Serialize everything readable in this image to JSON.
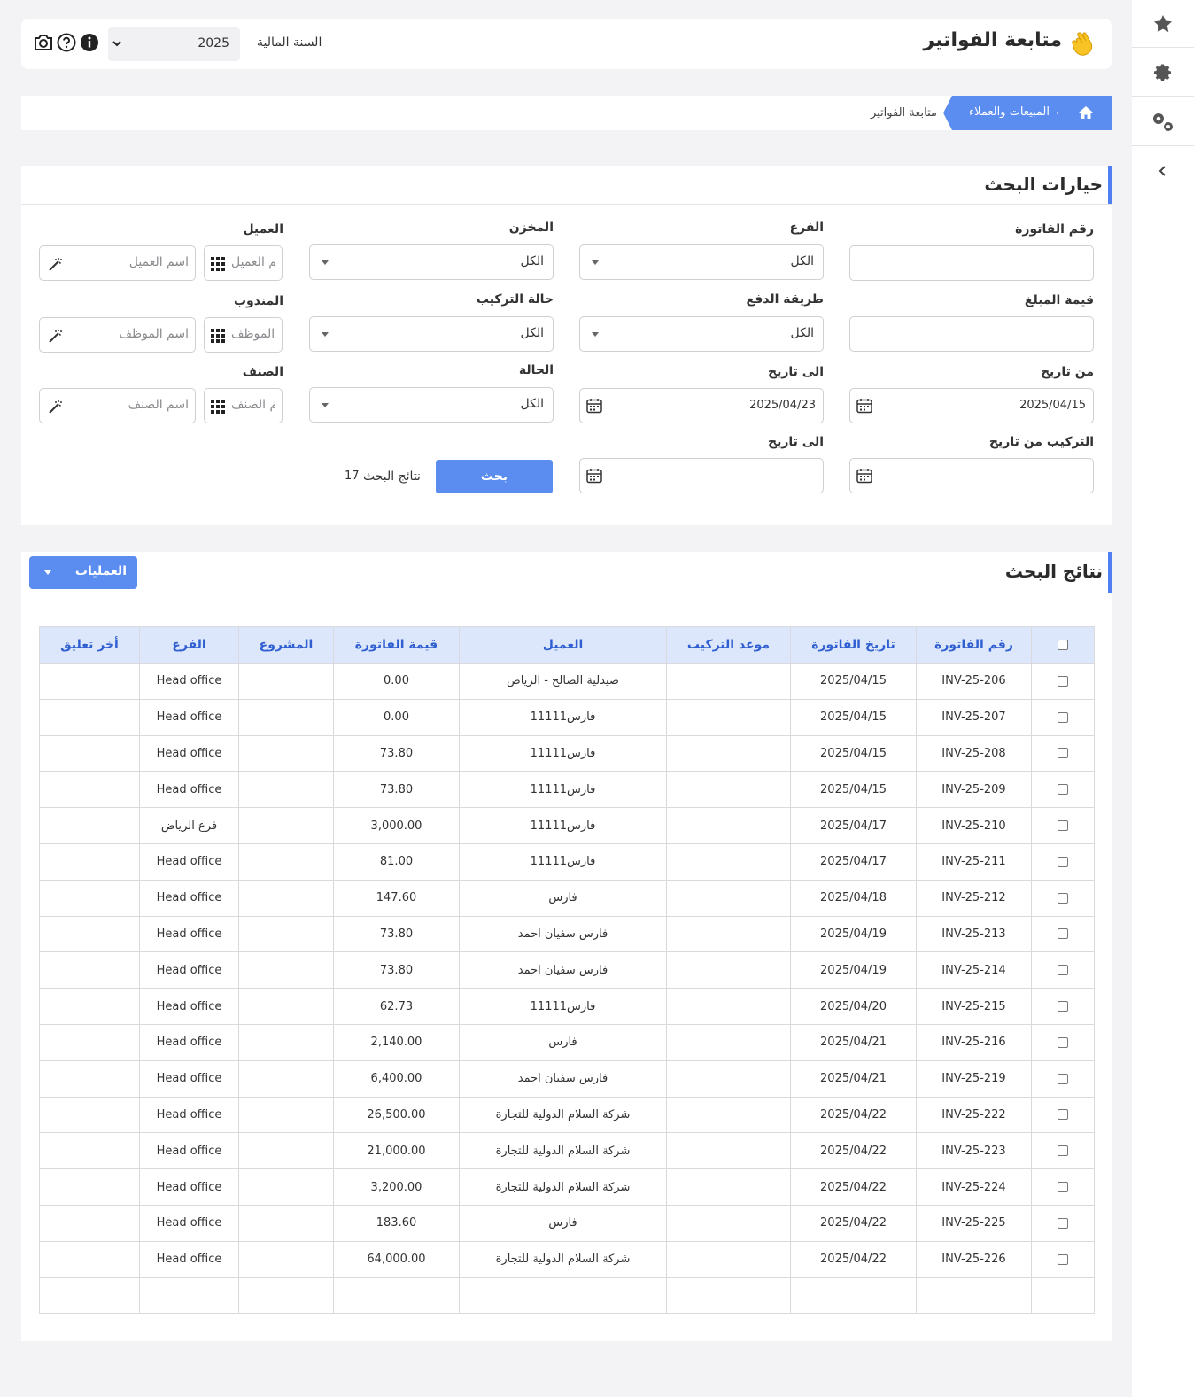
{
  "header": {
    "title": "متابعة الفواتير",
    "fiscal_year_label": "السنة المالية",
    "fiscal_year_value": "2025"
  },
  "breadcrumb": {
    "home_icon": "home-icon",
    "section": "المبيعات والعملاء",
    "current": "متابعة الفواتير"
  },
  "rail": {
    "icons": [
      "star-icon",
      "gear-icon",
      "gears-icon",
      "chevron-left-icon"
    ]
  },
  "search": {
    "title": "خيارات البحث",
    "invoice_no_label": "رقم الفاتورة",
    "branch_label": "الفرع",
    "branch_value": "الكل",
    "warehouse_label": "المخزن",
    "warehouse_value": "الكل",
    "customer_label": "العميل",
    "customer_no_placeholder": "رقم العميل",
    "customer_name_placeholder": "اسم العميل",
    "amount_label": "قيمة المبلغ",
    "payment_label": "طريقة الدفع",
    "payment_value": "الكل",
    "install_status_label": "حالة التركيب",
    "install_status_value": "الكل",
    "rep_label": "المندوب",
    "rep_no_placeholder": "رقم الموظف",
    "rep_name_placeholder": "اسم الموظف",
    "from_date_label": "من تاريخ",
    "from_date_value": "2025/04/15",
    "to_date_label": "الى تاريخ",
    "to_date_value": "2025/04/23",
    "status_label": "الحالة",
    "status_value": "الكل",
    "item_label": "الصنف",
    "item_no_placeholder": "رقم الصنف",
    "item_name_placeholder": "اسم الصنف",
    "install_from_label": "التركيب من تاريخ",
    "install_to_label": "الى تاريخ",
    "search_button": "بحث",
    "results_label": "نتائج البحث",
    "results_count": "17"
  },
  "results": {
    "title": "نتائج البحث",
    "operations_button": "العمليات",
    "columns": [
      "رقم الفاتورة",
      "تاريخ الفاتورة",
      "موعد التركيب",
      "العميل",
      "قيمة الفاتورة",
      "المشروع",
      "الفرع",
      "أخر تعليق"
    ],
    "rows": [
      {
        "invoice": "INV-25-206",
        "date": "2025/04/15",
        "install": "",
        "customer": "صيدلية الصالح - الرياض",
        "amount": "0.00",
        "project": "",
        "branch": "Head office",
        "comment": ""
      },
      {
        "invoice": "INV-25-207",
        "date": "2025/04/15",
        "install": "",
        "customer": "فارس11111",
        "amount": "0.00",
        "project": "",
        "branch": "Head office",
        "comment": ""
      },
      {
        "invoice": "INV-25-208",
        "date": "2025/04/15",
        "install": "",
        "customer": "فارس11111",
        "amount": "73.80",
        "project": "",
        "branch": "Head office",
        "comment": ""
      },
      {
        "invoice": "INV-25-209",
        "date": "2025/04/15",
        "install": "",
        "customer": "فارس11111",
        "amount": "73.80",
        "project": "",
        "branch": "Head office",
        "comment": ""
      },
      {
        "invoice": "INV-25-210",
        "date": "2025/04/17",
        "install": "",
        "customer": "فارس11111",
        "amount": "3,000.00",
        "project": "",
        "branch": "فرع الرياض",
        "comment": ""
      },
      {
        "invoice": "INV-25-211",
        "date": "2025/04/17",
        "install": "",
        "customer": "فارس11111",
        "amount": "81.00",
        "project": "",
        "branch": "Head office",
        "comment": ""
      },
      {
        "invoice": "INV-25-212",
        "date": "2025/04/18",
        "install": "",
        "customer": "فارس",
        "amount": "147.60",
        "project": "",
        "branch": "Head office",
        "comment": ""
      },
      {
        "invoice": "INV-25-213",
        "date": "2025/04/19",
        "install": "",
        "customer": "فارس سفيان احمد",
        "amount": "73.80",
        "project": "",
        "branch": "Head office",
        "comment": ""
      },
      {
        "invoice": "INV-25-214",
        "date": "2025/04/19",
        "install": "",
        "customer": "فارس سفيان احمد",
        "amount": "73.80",
        "project": "",
        "branch": "Head office",
        "comment": ""
      },
      {
        "invoice": "INV-25-215",
        "date": "2025/04/20",
        "install": "",
        "customer": "فارس11111",
        "amount": "62.73",
        "project": "",
        "branch": "Head office",
        "comment": ""
      },
      {
        "invoice": "INV-25-216",
        "date": "2025/04/21",
        "install": "",
        "customer": "فارس",
        "amount": "2,140.00",
        "project": "",
        "branch": "Head office",
        "comment": ""
      },
      {
        "invoice": "INV-25-219",
        "date": "2025/04/21",
        "install": "",
        "customer": "فارس سفيان احمد",
        "amount": "6,400.00",
        "project": "",
        "branch": "Head office",
        "comment": ""
      },
      {
        "invoice": "INV-25-222",
        "date": "2025/04/22",
        "install": "",
        "customer": "شركة السلام الدولية للتجارة",
        "amount": "26,500.00",
        "project": "",
        "branch": "Head office",
        "comment": ""
      },
      {
        "invoice": "INV-25-223",
        "date": "2025/04/22",
        "install": "",
        "customer": "شركة السلام الدولية للتجارة",
        "amount": "21,000.00",
        "project": "",
        "branch": "Head office",
        "comment": ""
      },
      {
        "invoice": "INV-25-224",
        "date": "2025/04/22",
        "install": "",
        "customer": "شركة السلام الدولية للتجارة",
        "amount": "3,200.00",
        "project": "",
        "branch": "Head office",
        "comment": ""
      },
      {
        "invoice": "INV-25-225",
        "date": "2025/04/22",
        "install": "",
        "customer": "فارس",
        "amount": "183.60",
        "project": "",
        "branch": "Head office",
        "comment": ""
      },
      {
        "invoice": "INV-25-226",
        "date": "2025/04/22",
        "install": "",
        "customer": "شركة السلام الدولية للتجارة",
        "amount": "64,000.00",
        "project": "",
        "branch": "Head office",
        "comment": ""
      }
    ]
  },
  "colors": {
    "accent": "#5b8df0",
    "link": "#2f64d6",
    "table_header_bg": "#dde7fb"
  }
}
